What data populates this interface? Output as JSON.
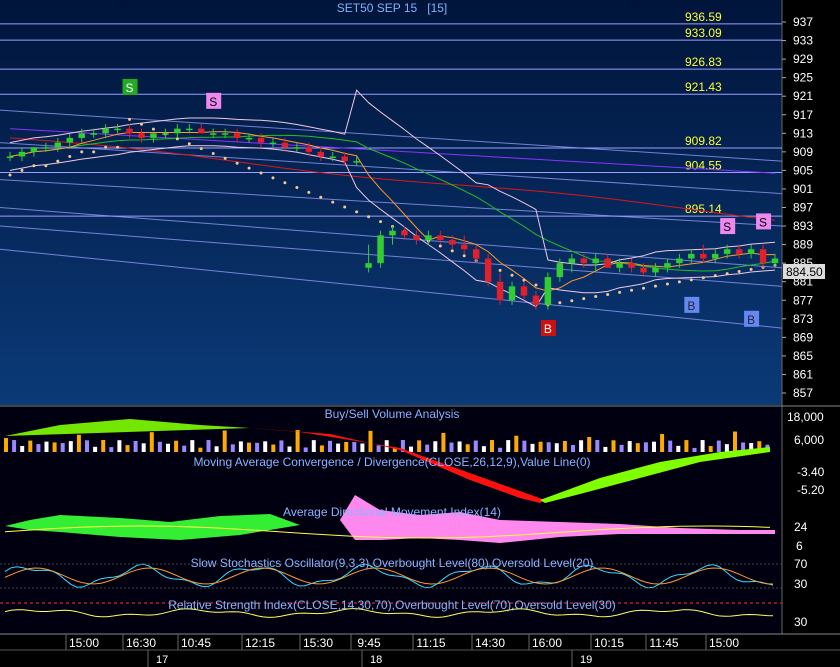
{
  "colors": {
    "panel_top": "#00143a",
    "panel_bottom": "#0b3a78",
    "up_candle": "#32cd32",
    "down_candle": "#e0202a",
    "bollinger": "#f0c8e0",
    "sar_dots": "#f4c890",
    "ma_orange": "#ff9933",
    "ma_green": "#22c022",
    "ma_red": "#d81818",
    "ma_purple": "#8833ff",
    "fib_line": "#9aa0ff",
    "fib_label": "#ffff33",
    "axis_text": "#ffffff",
    "vol_green": "#7fff00",
    "vol_red": "#ff1010",
    "adx_green": "#33ee33",
    "adx_pink": "#ff88ee",
    "buy_box": "#6688ee",
    "sell_box": "#ee88ee",
    "signal_green": "#22aa22",
    "signal_red": "#cc1111",
    "price_tag_bg": "#dcdcdc"
  },
  "chart_data": {
    "type": "candlestick",
    "title": "SET50 SEP 15   [15]",
    "last_price": "884.50",
    "ylim": [
      853,
      939
    ],
    "y_ticks": [
      "937",
      "933",
      "929",
      "925",
      "921",
      "917",
      "913",
      "909",
      "905",
      "901",
      "897",
      "893",
      "889",
      "885",
      "881",
      "877",
      "873",
      "869",
      "865",
      "861",
      "857"
    ],
    "fib_levels": [
      {
        "label": "936.59",
        "value": 936.59
      },
      {
        "label": "933.09",
        "value": 933.09
      },
      {
        "label": "926.83",
        "value": 926.83
      },
      {
        "label": "921.43",
        "value": 921.43
      },
      {
        "label": "909.82",
        "value": 909.82
      },
      {
        "label": "904.55",
        "value": 904.55
      },
      {
        "label": "895.14",
        "value": 895.14
      }
    ],
    "time_labels": [
      "15:00",
      "16:30",
      "10:45",
      "12:15",
      "15:30",
      "9:45",
      "11:15",
      "14:30",
      "16:00",
      "10:15",
      "11:45",
      "15:00"
    ],
    "date_labels": [
      "17",
      "18",
      "19"
    ],
    "candles": [
      [
        908,
        909,
        907,
        908
      ],
      [
        908,
        910,
        907,
        909
      ],
      [
        909,
        910,
        908,
        910
      ],
      [
        910,
        911,
        909,
        910
      ],
      [
        910,
        912,
        909,
        911
      ],
      [
        911,
        913,
        910,
        912
      ],
      [
        912,
        914,
        911,
        913
      ],
      [
        913,
        914,
        912,
        913
      ],
      [
        913,
        915,
        912,
        914
      ],
      [
        914,
        915,
        913,
        914
      ],
      [
        914,
        915,
        912,
        913
      ],
      [
        913,
        914,
        911,
        912
      ],
      [
        912,
        913,
        911,
        913
      ],
      [
        913,
        914,
        912,
        913
      ],
      [
        913,
        915,
        912,
        914
      ],
      [
        914,
        915,
        913,
        914
      ],
      [
        914,
        915,
        913,
        913
      ],
      [
        913,
        914,
        912,
        913
      ],
      [
        913,
        914,
        912,
        913
      ],
      [
        913,
        914,
        911,
        912
      ],
      [
        912,
        913,
        911,
        912
      ],
      [
        912,
        913,
        910,
        911
      ],
      [
        911,
        912,
        910,
        911
      ],
      [
        911,
        912,
        909,
        910
      ],
      [
        910,
        911,
        909,
        910
      ],
      [
        910,
        911,
        908,
        909
      ],
      [
        909,
        910,
        907,
        908
      ],
      [
        908,
        909,
        907,
        908
      ],
      [
        908,
        909,
        906,
        907
      ],
      [
        907,
        908,
        906,
        907
      ],
      [
        884,
        889,
        883,
        885
      ],
      [
        885,
        892,
        884,
        891
      ],
      [
        891,
        893,
        889,
        892
      ],
      [
        892,
        893,
        890,
        891
      ],
      [
        891,
        892,
        889,
        890
      ],
      [
        890,
        892,
        889,
        891
      ],
      [
        891,
        892,
        889,
        890
      ],
      [
        890,
        891,
        888,
        889
      ],
      [
        889,
        891,
        887,
        888
      ],
      [
        888,
        889,
        885,
        886
      ],
      [
        886,
        887,
        880,
        881
      ],
      [
        881,
        883,
        876,
        877
      ],
      [
        877,
        881,
        876,
        880
      ],
      [
        880,
        881,
        877,
        878
      ],
      [
        878,
        879,
        875,
        876
      ],
      [
        876,
        883,
        875,
        882
      ],
      [
        882,
        886,
        881,
        885
      ],
      [
        885,
        887,
        883,
        886
      ],
      [
        886,
        887,
        884,
        885
      ],
      [
        885,
        887,
        883,
        886
      ],
      [
        886,
        887,
        884,
        884
      ],
      [
        884,
        886,
        883,
        885
      ],
      [
        885,
        886,
        883,
        884
      ],
      [
        884,
        885,
        882,
        883
      ],
      [
        883,
        885,
        882,
        884
      ],
      [
        884,
        886,
        883,
        885
      ],
      [
        885,
        887,
        884,
        886
      ],
      [
        886,
        888,
        885,
        887
      ],
      [
        887,
        889,
        885,
        886
      ],
      [
        886,
        888,
        885,
        887
      ],
      [
        887,
        889,
        886,
        888
      ],
      [
        888,
        889,
        886,
        887
      ],
      [
        887,
        889,
        886,
        888
      ],
      [
        888,
        889,
        884,
        885
      ],
      [
        885,
        887,
        884,
        886
      ]
    ],
    "signals": [
      {
        "label": "S",
        "type": "sell-green",
        "index": 10,
        "price": 923
      },
      {
        "label": "S",
        "type": "sell",
        "index": 17,
        "price": 920
      },
      {
        "label": "B",
        "type": "buy-red",
        "index": 45,
        "price": 871
      },
      {
        "label": "B",
        "type": "buy",
        "index": 57,
        "price": 876
      },
      {
        "label": "S",
        "type": "sell",
        "index": 60,
        "price": 893
      },
      {
        "label": "S",
        "type": "sell",
        "index": 63,
        "price": 894
      },
      {
        "label": "B",
        "type": "buy",
        "index": 62,
        "price": 873
      }
    ],
    "volume_panel": {
      "title": "Buy/Sell Volume Analysis",
      "ticks": [
        "18,000",
        "6,000"
      ]
    },
    "macd_panel": {
      "title": "Moving Average Convergence / Divergence(CLOSE,26,12,9),Value Line(0)",
      "ticks": [
        "-3.40",
        "-5.20"
      ]
    },
    "adx_panel": {
      "title": "Average Directional Movement Index(14)",
      "ticks": [
        "24",
        "6"
      ]
    },
    "stoch_panel": {
      "title": "Slow Stochastics Oscillator(9,3,3),Overbought Level(80),Oversold Level(20)",
      "ticks": [
        "70",
        "30"
      ]
    },
    "rsi_panel": {
      "title": "Relative Strength Index(CLOSE,14,30,70),Overbought Level(70),Oversold Level(30)",
      "ticks": [
        "30"
      ]
    }
  }
}
